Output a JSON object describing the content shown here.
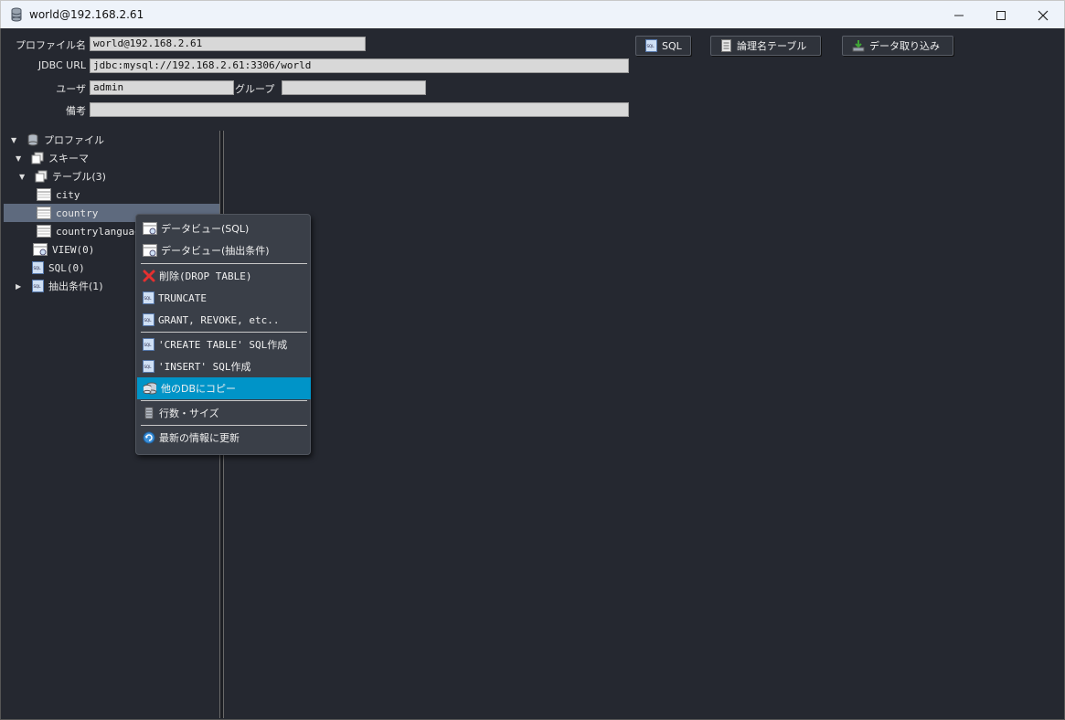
{
  "window": {
    "title": "world@192.168.2.61"
  },
  "form": {
    "profile_label": "プロファイル名",
    "profile_value": "world@192.168.2.61",
    "jdbc_label": "JDBC URL",
    "jdbc_value": "jdbc:mysql://192.168.2.61:3306/world",
    "user_label": "ユーザ",
    "user_value": "admin",
    "group_label": "グループ",
    "group_value": "",
    "note_label": "備考",
    "note_value": ""
  },
  "toolbar": {
    "sql_label": "SQL",
    "logical_label": "論理名テーブル",
    "import_label": "データ取り込み"
  },
  "tree": {
    "profile": "プロファイル",
    "schema": "スキーマ",
    "tables": "テーブル(3)",
    "table_city": "city",
    "table_country": "country",
    "table_countrylanguage": "countrylanguage",
    "view": "VIEW(0)",
    "sql": "SQL(0)",
    "filter": "抽出条件(1)"
  },
  "context_menu": {
    "items": [
      "データビュー(SQL)",
      "データビュー(抽出条件)",
      "削除(DROP TABLE)",
      "TRUNCATE",
      "GRANT, REVOKE, etc..",
      "'CREATE TABLE' SQL作成",
      "'INSERT' SQL作成",
      "他のDBにコピー",
      "行数・サイズ",
      "最新の情報に更新"
    ]
  },
  "colors": {
    "background": "#252830",
    "menu_highlight": "#0094c8",
    "selected_row": "#5e6a7e"
  }
}
